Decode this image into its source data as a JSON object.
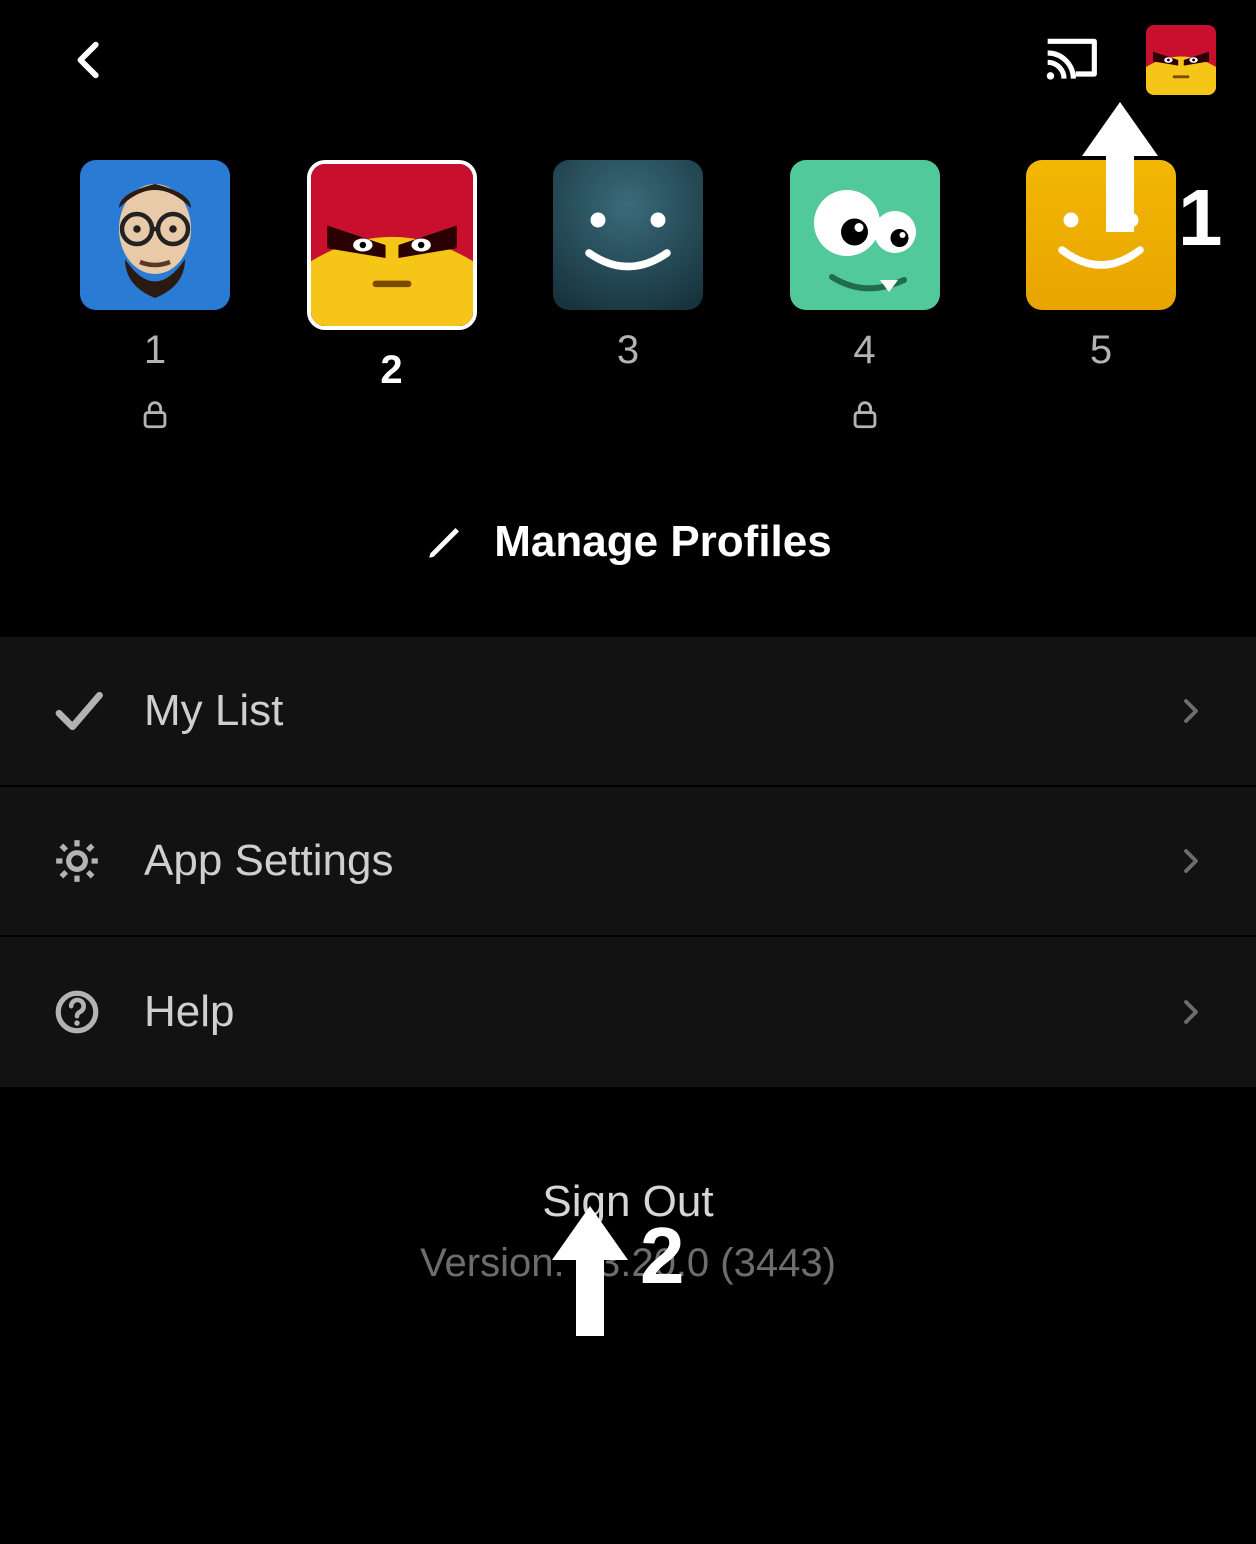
{
  "header": {
    "back_icon": "back-chevron",
    "cast_icon": "cast",
    "avatar_icon": "angry-red"
  },
  "profiles": [
    {
      "label": "1",
      "avatar": "professor",
      "selected": false,
      "locked": true
    },
    {
      "label": "2",
      "avatar": "angry-red",
      "selected": true,
      "locked": false
    },
    {
      "label": "3",
      "avatar": "smile-teal",
      "selected": false,
      "locked": false
    },
    {
      "label": "4",
      "avatar": "monster-green",
      "selected": false,
      "locked": true
    },
    {
      "label": "5",
      "avatar": "smile-yellow",
      "selected": false,
      "locked": false
    }
  ],
  "manage_profiles_label": "Manage Profiles",
  "menu": [
    {
      "icon": "check",
      "label": "My List"
    },
    {
      "icon": "gear",
      "label": "App Settings"
    },
    {
      "icon": "help",
      "label": "Help"
    }
  ],
  "footer": {
    "signout_label": "Sign Out",
    "version_label": "Version: 13.20.0 (3443)"
  },
  "annotations": {
    "step1": "1",
    "step2": "2"
  }
}
